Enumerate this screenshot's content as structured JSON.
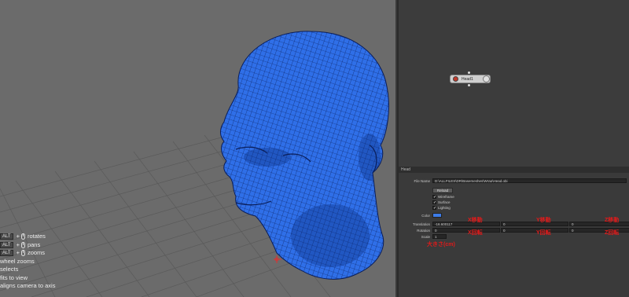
{
  "viewport": {
    "help": [
      {
        "key": "ALT",
        "action": "rotates"
      },
      {
        "key": "ALT",
        "action": "pans"
      },
      {
        "key": "ALT",
        "action": "zooms"
      },
      {
        "action": "wheel zooms"
      },
      {
        "action": "selects"
      },
      {
        "action": "fits to view"
      },
      {
        "action": "aligns camera to axis"
      }
    ]
  },
  "graph": {
    "node_label": "Head1"
  },
  "properties": {
    "panel_title": "Head",
    "file_name_label": "File Name",
    "file_name_value": "D:\\ALLFILES\\DR\\Basemeshes\\Wrap\\Head.obj",
    "reload_label": "Reload",
    "wireframe_label": "Wireframe",
    "surface_label": "Surface",
    "lighting_label": "Lighting",
    "color_label": "Color",
    "color_value": "#3d7ce8",
    "translation_label": "Translation",
    "rotation_label": "Rotation",
    "scale_label": "Scale",
    "translation_values": [
      "-16.600117",
      "0",
      "0"
    ],
    "rotation_values": [
      "0",
      "0",
      "0"
    ],
    "scale_value": "1"
  },
  "annotations": {
    "x_move": "X移動",
    "y_move": "Y移動",
    "z_move": "Z移動",
    "x_rot": "X回転",
    "y_rot": "Y回転",
    "z_rot": "Z回転",
    "scale_note": "大きさ(cm)"
  },
  "colors": {
    "mesh_fill": "#2f6fe8",
    "mesh_line": "#0a1e5a",
    "annotation": "#e11a1a"
  }
}
